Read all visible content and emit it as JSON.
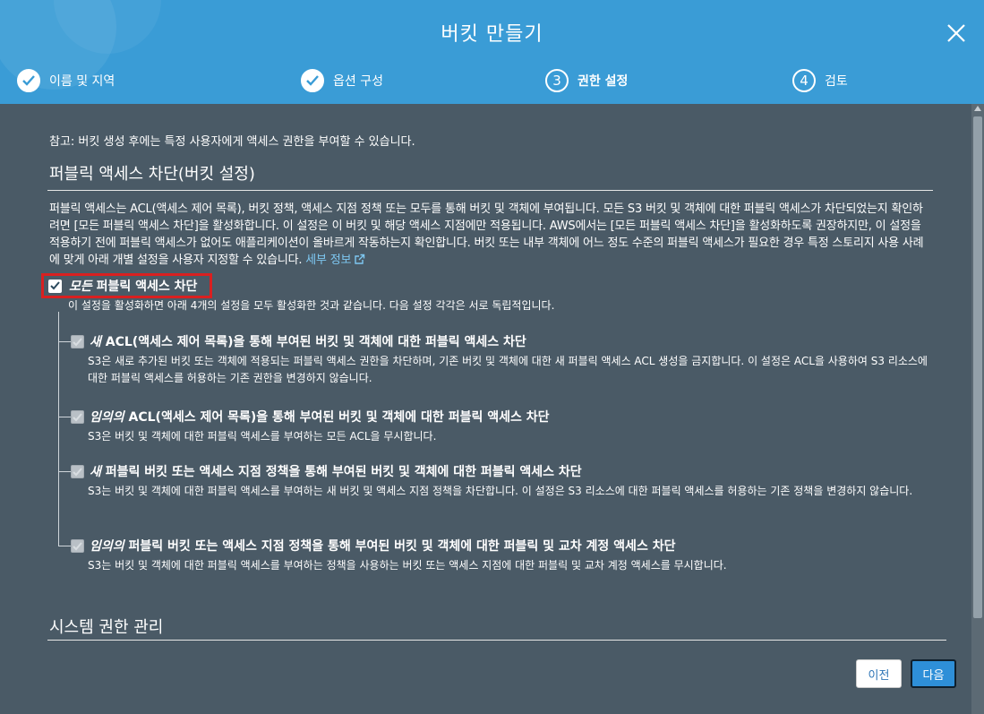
{
  "modal": {
    "title": "버킷 만들기"
  },
  "steps": [
    {
      "label": "이름 및 지역",
      "marker": "✓",
      "state": "done"
    },
    {
      "label": "옵션 구성",
      "marker": "✓",
      "state": "done"
    },
    {
      "label": "권한 설정",
      "marker": "3",
      "state": "active"
    },
    {
      "label": "검토",
      "marker": "4",
      "state": "pending"
    }
  ],
  "note": "참고: 버킷 생성 후에는 특정 사용자에게 액세스 권한을 부여할 수 있습니다.",
  "public_access": {
    "section_title": "퍼블릭 액세스 차단(버킷 설정)",
    "description": "퍼블릭 액세스는 ACL(액세스 제어 목록), 버킷 정책, 액세스 지점 정책 또는 모두를 통해 버킷 및 객체에 부여됩니다. 모든 S3 버킷 및 객체에 대한 퍼블릭 액세스가 차단되었는지 확인하려면 [모든 퍼블릭 액세스 차단]을 활성화합니다. 이 설정은 이 버킷 및 해당 액세스 지점에만 적용됩니다. AWS에서는 [모든 퍼블릭 액세스 차단]을 활성화하도록 권장하지만, 이 설정을 적용하기 전에 퍼블릭 액세스가 없어도 애플리케이션이 올바르게 작동하는지 확인합니다. 버킷 또는 내부 객체에 어느 정도 수준의 퍼블릭 액세스가 필요한 경우 특정 스토리지 사용 사례에 맞게 아래 개별 설정을 사용자 지정할 수 있습니다.",
    "learn_more": "세부 정보",
    "master": {
      "label_em": "모든",
      "label": "퍼블릭 액세스 차단",
      "checked": true,
      "subtext": "이 설정을 활성화하면 아래 4개의 설정을 모두 활성화한 것과 같습니다. 다음 설정 각각은 서로 독립적입니다."
    },
    "options": [
      {
        "em": "새",
        "title": "ACL(액세스 제어 목록)을 통해 부여된 버킷 및 객체에 대한 퍼블릭 액세스 차단",
        "body": "S3은 새로 추가된 버킷 또는 객체에 적용되는 퍼블릭 액세스 권한을 차단하며, 기존 버킷 및 객체에 대한 새 퍼블릭 액세스 ACL 생성을 금지합니다. 이 설정은 ACL을 사용하여 S3 리소스에 대한 퍼블릭 액세스를 허용하는 기존 권한을 변경하지 않습니다."
      },
      {
        "em": "임의의",
        "title": "ACL(액세스 제어 목록)을 통해 부여된 버킷 및 객체에 대한 퍼블릭 액세스 차단",
        "body": "S3은 버킷 및 객체에 대한 퍼블릭 액세스를 부여하는 모든 ACL을 무시합니다."
      },
      {
        "em": "새",
        "title": "퍼블릭 버킷 또는 액세스 지점 정책을 통해 부여된 버킷 및 객체에 대한 퍼블릭 액세스 차단",
        "body": "S3는 버킷 및 객체에 대한 퍼블릭 액세스를 부여하는 새 버킷 및 액세스 지점 정책을 차단합니다. 이 설정은 S3 리소스에 대한 퍼블릭 액세스를 허용하는 기존 정책을 변경하지 않습니다."
      },
      {
        "em": "임의의",
        "title": "퍼블릭 버킷 또는 액세스 지점 정책을 통해 부여된 버킷 및 객체에 대한 퍼블릭 및 교차 계정 액세스 차단",
        "body": "S3는 버킷 및 객체에 대한 퍼블릭 액세스를 부여하는 정책을 사용하는 버킷 또는 액세스 지점에 대한 퍼블릭 및 교차 계정 액세스를 무시합니다."
      }
    ]
  },
  "system_permissions": {
    "section_title": "시스템 권한 관리"
  },
  "footer": {
    "prev_label": "이전",
    "next_label": "다음"
  }
}
